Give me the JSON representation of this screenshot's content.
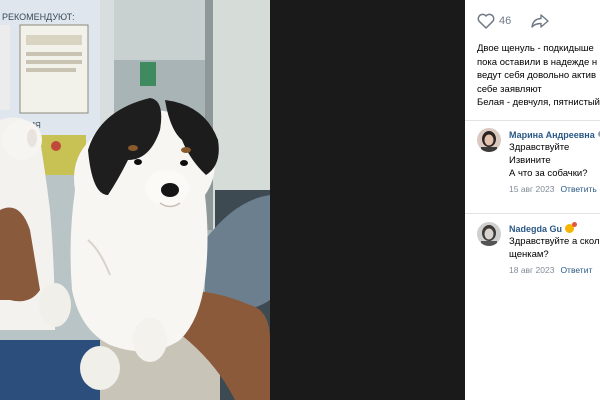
{
  "post": {
    "likes": "46",
    "text_lines": [
      "Двое щенуль - подкидыше",
      "пока оставили в надежде н",
      "ведут себя довольно актив",
      "себе заявляют",
      "Белая - девчуля, пятнистый"
    ]
  },
  "poster": {
    "sign_text": "РЕКОМЕНДУЮТ:",
    "sign_text_2": "АЦИЯ"
  },
  "comments": [
    {
      "name": "Марина Андреевна",
      "lines": [
        "Здравствуйте",
        "Извините",
        "А что за собачки?"
      ],
      "date": "15 авг 2023",
      "reply": "Ответить"
    },
    {
      "name": "Nadegda Gu",
      "lines": [
        "Здравствуйте а скол",
        "щенкам?"
      ],
      "date": "18 авг 2023",
      "reply": "Ответит"
    }
  ],
  "icons": {
    "like": "heart-icon",
    "share": "share-arrow-icon"
  }
}
